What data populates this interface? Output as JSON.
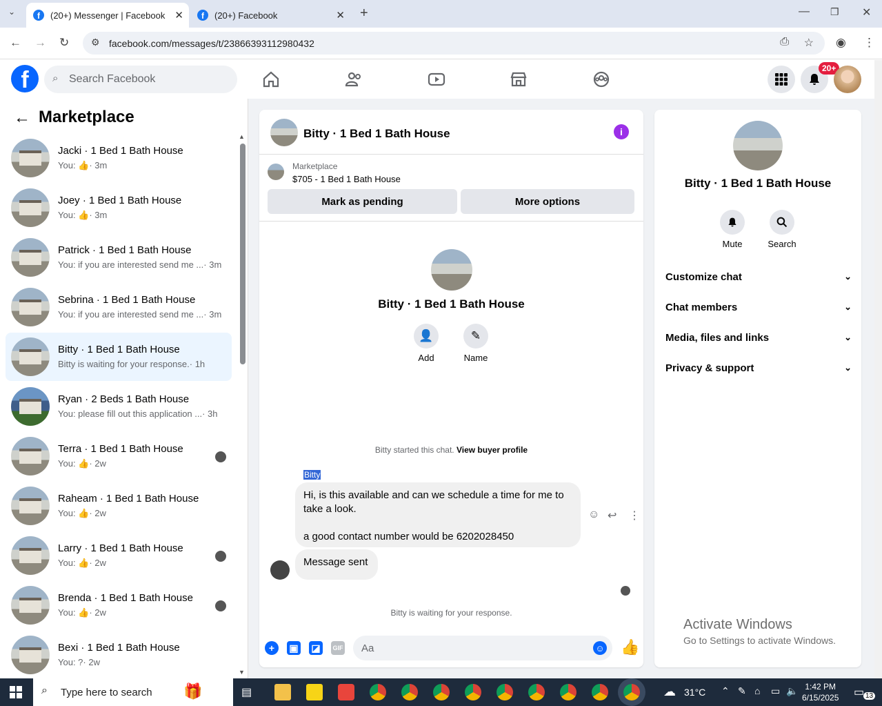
{
  "browser": {
    "tabs": [
      {
        "title": "(20+) Messenger | Facebook",
        "active": true
      },
      {
        "title": "(20+) Facebook",
        "active": false
      }
    ],
    "url": "facebook.com/messages/t/23866393112980432"
  },
  "header": {
    "search_placeholder": "Search Facebook",
    "notification_badge": "20+",
    "nav_icons": [
      "home-icon",
      "friends-icon",
      "video-icon",
      "marketplace-icon",
      "groups-icon"
    ]
  },
  "left_panel": {
    "title": "Marketplace",
    "conversations": [
      {
        "name": "Jacki · 1 Bed 1 Bath House",
        "snippet_prefix": "You: ",
        "snippet_like": true,
        "snippet": "",
        "time": "· 3m"
      },
      {
        "name": "Joey · 1 Bed 1 Bath House",
        "snippet_prefix": "You: ",
        "snippet_like": true,
        "snippet": "",
        "time": "· 3m"
      },
      {
        "name": "Patrick · 1 Bed 1 Bath House",
        "snippet_prefix": "You: ",
        "snippet_like": false,
        "snippet": "if you are interested send me ...",
        "time": "· 3m"
      },
      {
        "name": "Sebrina · 1 Bed 1 Bath House",
        "snippet_prefix": "You: ",
        "snippet_like": false,
        "snippet": "if you are interested send me ...",
        "time": "· 3m"
      },
      {
        "name": "Bitty · 1 Bed 1 Bath House",
        "snippet_prefix": "",
        "snippet_like": false,
        "snippet": "Bitty is waiting for your response.",
        "time": "· 1h",
        "active": true
      },
      {
        "name": "Ryan · 2 Beds 1 Bath House",
        "snippet_prefix": "You: ",
        "snippet_like": false,
        "snippet": "please fill out this application ...",
        "time": "· 3h"
      },
      {
        "name": "Terra · 1 Bed 1 Bath House",
        "snippet_prefix": "You: ",
        "snippet_like": true,
        "snippet": "",
        "time": "· 2w"
      },
      {
        "name": "Raheam · 1 Bed 1 Bath House",
        "snippet_prefix": "You: ",
        "snippet_like": true,
        "snippet": "",
        "time": "· 2w"
      },
      {
        "name": "Larry · 1 Bed 1 Bath House",
        "snippet_prefix": "You: ",
        "snippet_like": true,
        "snippet": "",
        "time": "· 2w"
      },
      {
        "name": "Brenda · 1 Bed 1 Bath House",
        "snippet_prefix": "You: ",
        "snippet_like": true,
        "snippet": "",
        "time": "· 2w"
      },
      {
        "name": "Bexi · 1 Bed 1 Bath House",
        "snippet_prefix": "You: ",
        "snippet_like": false,
        "snippet": "?",
        "time": "· 2w"
      }
    ]
  },
  "chat": {
    "title": "Bitty · 1 Bed 1 Bath House",
    "marketplace_label": "Marketplace",
    "listing": "$705 - 1 Bed 1 Bath House",
    "mark_pending": "Mark as pending",
    "more_options": "More options",
    "intro_name": "Bitty · 1 Bed 1 Bath House",
    "add_label": "Add",
    "name_label": "Name",
    "started_text": "Bitty started this chat.",
    "view_profile": "View buyer profile",
    "sender": "Bitty",
    "message_line1": "Hi, is this available and can we schedule a time for me to take a look.",
    "message_line2": "a good contact number would be 6202028450",
    "message2": "Message sent",
    "waiting": "Bitty is waiting for your response.",
    "composer_placeholder": "Aa"
  },
  "right_panel": {
    "name": "Bitty · 1 Bed 1 Bath House",
    "mute": "Mute",
    "search": "Search",
    "sections": [
      "Customize chat",
      "Chat members",
      "Media, files and links",
      "Privacy & support"
    ]
  },
  "watermark": {
    "line1": "Activate Windows",
    "line2": "Go to Settings to activate Windows."
  },
  "taskbar": {
    "search_placeholder": "Type here to search",
    "temperature": "31°C",
    "time": "1:42 PM",
    "date": "6/15/2025",
    "notification_count": "13"
  }
}
